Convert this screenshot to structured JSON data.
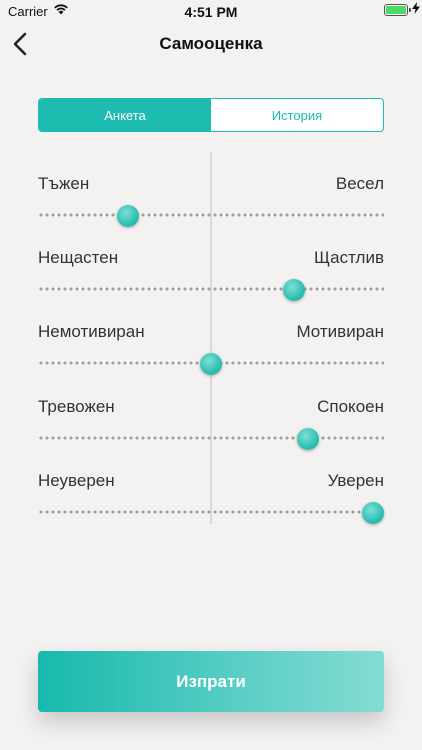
{
  "status_bar": {
    "carrier": "Carrier",
    "time": "4:51 PM",
    "battery_level": 1.0,
    "battery_color": "#4cd964"
  },
  "nav": {
    "back_icon": "chevron-left-icon",
    "title": "Самооценка"
  },
  "tabs": [
    {
      "label": "Анкета",
      "active": true
    },
    {
      "label": "История",
      "active": false
    }
  ],
  "sliders": [
    {
      "left_label": "Тъжен",
      "right_label": "Весел",
      "value": 0.26
    },
    {
      "left_label": "Нещастен",
      "right_label": "Щастлив",
      "value": 0.74
    },
    {
      "left_label": "Немотивиран",
      "right_label": "Мотивиран",
      "value": 0.5
    },
    {
      "left_label": "Тревожен",
      "right_label": "Спокоен",
      "value": 0.78
    },
    {
      "left_label": "Неуверен",
      "right_label": "Уверен",
      "value": 0.98
    }
  ],
  "submit_label": "Изпрати",
  "colors": {
    "accent": "#1ebcb0",
    "background": "#f3f2f1"
  }
}
